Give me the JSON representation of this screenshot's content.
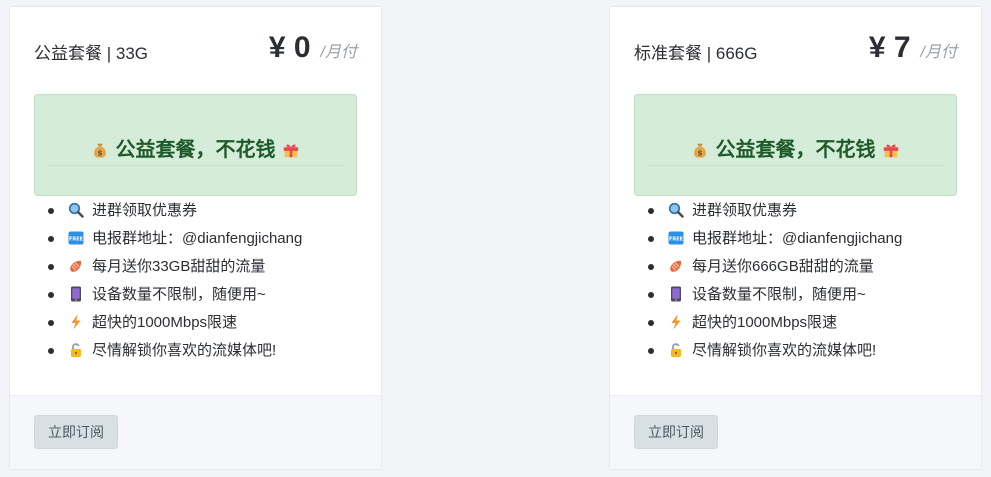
{
  "cards": [
    {
      "plan_name": "公益套餐 | 33G",
      "price": "¥ 0",
      "period": "/月付",
      "banner_text": "公益套餐，不花钱",
      "features": [
        {
          "icon": "magnifier-icon",
          "text": "进群领取优惠券"
        },
        {
          "icon": "free-badge-icon",
          "text": "电报群地址：@dianfengjichang"
        },
        {
          "icon": "candy-icon",
          "text": "每月送你33GB甜甜的流量"
        },
        {
          "icon": "phone-icon",
          "text": "设备数量不限制，随便用~"
        },
        {
          "icon": "lightning-icon",
          "text": "超快的1000Mbps限速"
        },
        {
          "icon": "unlock-icon",
          "text": "尽情解锁你喜欢的流媒体吧!"
        }
      ],
      "button_label": "立即订阅"
    },
    {
      "plan_name": "标准套餐 | 666G",
      "price": "¥ 7",
      "period": "/月付",
      "banner_text": "公益套餐，不花钱",
      "features": [
        {
          "icon": "magnifier-icon",
          "text": "进群领取优惠券"
        },
        {
          "icon": "free-badge-icon",
          "text": "电报群地址：@dianfengjichang"
        },
        {
          "icon": "candy-icon",
          "text": "每月送你666GB甜甜的流量"
        },
        {
          "icon": "phone-icon",
          "text": "设备数量不限制，随便用~"
        },
        {
          "icon": "lightning-icon",
          "text": "超快的1000Mbps限速"
        },
        {
          "icon": "unlock-icon",
          "text": "尽情解锁你喜欢的流媒体吧!"
        }
      ],
      "button_label": "立即订阅"
    }
  ],
  "colors": {
    "banner_bg": "#d5ecd9",
    "banner_text": "#1f5a2b",
    "button_bg": "#d9e0e4"
  }
}
